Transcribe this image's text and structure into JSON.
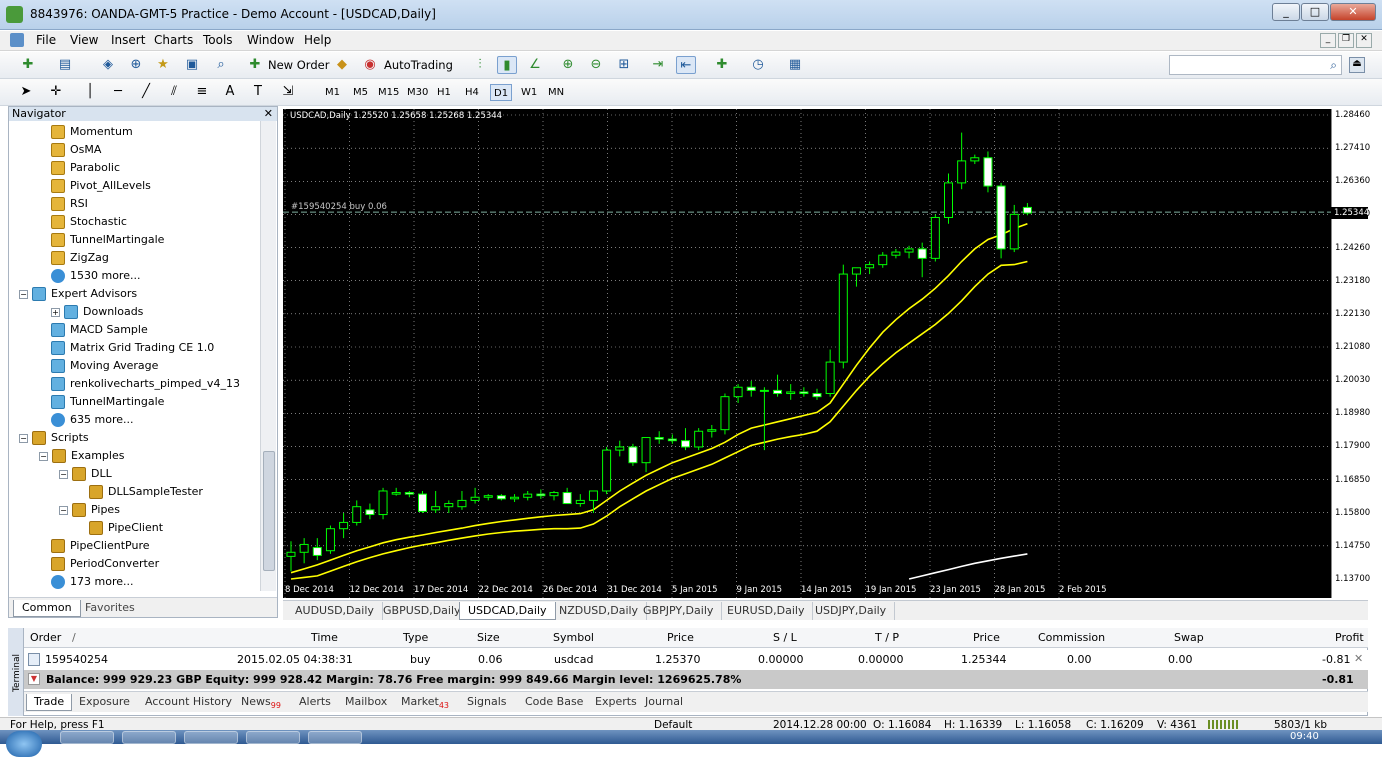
{
  "window": {
    "title": "8843976: OANDA-GMT-5 Practice - Demo Account - [USDCAD,Daily]",
    "buttons": [
      "_",
      "□",
      "✕"
    ]
  },
  "menu": [
    "File",
    "View",
    "Insert",
    "Charts",
    "Tools",
    "Window",
    "Help"
  ],
  "toolbar": {
    "new_order": "New Order",
    "autotrading": "AutoTrading",
    "timeframes": [
      "M1",
      "M5",
      "M15",
      "M30",
      "H1",
      "H4",
      "D1",
      "W1",
      "MN"
    ],
    "active_timeframe": "D1"
  },
  "navigator": {
    "title": "Navigator",
    "close": "✕",
    "items": [
      {
        "label": "Momentum",
        "icon": "indicator-icon"
      },
      {
        "label": "OsMA",
        "icon": "indicator-icon"
      },
      {
        "label": "Parabolic",
        "icon": "indicator-icon"
      },
      {
        "label": "Pivot_AllLevels",
        "icon": "indicator-icon"
      },
      {
        "label": "RSI",
        "icon": "indicator-icon"
      },
      {
        "label": "Stochastic",
        "icon": "indicator-icon"
      },
      {
        "label": "TunnelMartingale",
        "icon": "indicator-icon"
      },
      {
        "label": "ZigZag",
        "icon": "indicator-icon"
      },
      {
        "label": "1530 more...",
        "icon": "globe-icon"
      },
      {
        "label": "Expert Advisors",
        "icon": "expert-folder-icon"
      },
      {
        "label": "Downloads",
        "icon": "expert-icon"
      },
      {
        "label": "MACD Sample",
        "icon": "expert-icon"
      },
      {
        "label": "Matrix Grid Trading CE 1.0",
        "icon": "expert-icon"
      },
      {
        "label": "Moving Average",
        "icon": "expert-icon"
      },
      {
        "label": "renkolivecharts_pimped_v4_13",
        "icon": "expert-icon"
      },
      {
        "label": "TunnelMartingale",
        "icon": "expert-icon"
      },
      {
        "label": "635 more...",
        "icon": "globe-icon"
      },
      {
        "label": "Scripts",
        "icon": "script-folder-icon"
      },
      {
        "label": "Examples",
        "icon": "script-folder-icon"
      },
      {
        "label": "DLL",
        "icon": "script-folder-icon"
      },
      {
        "label": "DLLSampleTester",
        "icon": "script-icon"
      },
      {
        "label": "Pipes",
        "icon": "script-folder-icon"
      },
      {
        "label": "PipeClient",
        "icon": "script-icon"
      },
      {
        "label": "PipeClientPure",
        "icon": "script-icon"
      },
      {
        "label": "PeriodConverter",
        "icon": "script-icon"
      },
      {
        "label": "173 more...",
        "icon": "globe-icon"
      }
    ],
    "tabs": [
      "Common",
      "Favorites"
    ],
    "active_tab": "Common"
  },
  "chart": {
    "header": "USDCAD,Daily  1.25520 1.25658 1.25268 1.25344",
    "order_line_label": "#159540254 buy 0.06",
    "current_price": "1.25344",
    "price_ticks": [
      "1.28460",
      "1.27410",
      "1.26360",
      "1.25310",
      "1.24260",
      "1.23180",
      "1.22130",
      "1.21080",
      "1.20030",
      "1.18980",
      "1.17900",
      "1.16850",
      "1.15800",
      "1.14750",
      "1.13700"
    ],
    "date_ticks": [
      "8 Dec 2014",
      "12 Dec 2014",
      "17 Dec 2014",
      "22 Dec 2014",
      "26 Dec 2014",
      "31 Dec 2014",
      "5 Jan 2015",
      "9 Jan 2015",
      "14 Jan 2015",
      "19 Jan 2015",
      "23 Jan 2015",
      "28 Jan 2015",
      "2 Feb 2015"
    ],
    "tabs": [
      "AUDUSD,Daily",
      "GBPUSD,Daily",
      "USDCAD,Daily",
      "NZDUSD,Daily",
      "GBPJPY,Daily",
      "EURUSD,Daily",
      "USDJPY,Daily"
    ],
    "active_tab": "USDCAD,Daily"
  },
  "chart_data": {
    "type": "line",
    "title": "USDCAD,Daily",
    "ylim": [
      1.137,
      1.2846
    ],
    "candles": [
      [
        1.1442,
        1.149,
        1.1395,
        1.1455
      ],
      [
        1.1455,
        1.15,
        1.142,
        1.148
      ],
      [
        1.147,
        1.15,
        1.143,
        1.1445
      ],
      [
        1.146,
        1.154,
        1.145,
        1.153
      ],
      [
        1.153,
        1.158,
        1.15,
        1.155
      ],
      [
        1.155,
        1.162,
        1.154,
        1.16
      ],
      [
        1.159,
        1.161,
        1.156,
        1.1575
      ],
      [
        1.1575,
        1.166,
        1.156,
        1.165
      ],
      [
        1.164,
        1.166,
        1.1635,
        1.1645
      ],
      [
        1.1645,
        1.165,
        1.163,
        1.164
      ],
      [
        1.164,
        1.165,
        1.158,
        1.1585
      ],
      [
        1.159,
        1.165,
        1.158,
        1.16
      ],
      [
        1.16,
        1.162,
        1.158,
        1.161
      ],
      [
        1.16,
        1.165,
        1.159,
        1.162
      ],
      [
        1.162,
        1.166,
        1.161,
        1.163
      ],
      [
        1.163,
        1.164,
        1.162,
        1.1635
      ],
      [
        1.1635,
        1.164,
        1.162,
        1.1625
      ],
      [
        1.1625,
        1.164,
        1.1615,
        1.163
      ],
      [
        1.163,
        1.165,
        1.162,
        1.164
      ],
      [
        1.164,
        1.1655,
        1.1625,
        1.1635
      ],
      [
        1.1635,
        1.165,
        1.162,
        1.1645
      ],
      [
        1.1645,
        1.166,
        1.161,
        1.161
      ],
      [
        1.161,
        1.164,
        1.16,
        1.162
      ],
      [
        1.162,
        1.165,
        1.158,
        1.165
      ],
      [
        1.165,
        1.179,
        1.164,
        1.178
      ],
      [
        1.178,
        1.181,
        1.176,
        1.179
      ],
      [
        1.179,
        1.18,
        1.173,
        1.174
      ],
      [
        1.174,
        1.182,
        1.171,
        1.182
      ],
      [
        1.182,
        1.184,
        1.18,
        1.1815
      ],
      [
        1.1815,
        1.183,
        1.18,
        1.181
      ],
      [
        1.181,
        1.185,
        1.178,
        1.179
      ],
      [
        1.179,
        1.185,
        1.178,
        1.184
      ],
      [
        1.184,
        1.186,
        1.182,
        1.1845
      ],
      [
        1.1845,
        1.196,
        1.183,
        1.195
      ],
      [
        1.195,
        1.199,
        1.193,
        1.198
      ],
      [
        1.198,
        1.2,
        1.195,
        1.197
      ],
      [
        1.197,
        1.198,
        1.178,
        1.197
      ],
      [
        1.197,
        1.202,
        1.195,
        1.196
      ],
      [
        1.196,
        1.199,
        1.194,
        1.1965
      ],
      [
        1.1965,
        1.198,
        1.195,
        1.196
      ],
      [
        1.196,
        1.1975,
        1.194,
        1.195
      ],
      [
        1.196,
        1.21,
        1.195,
        1.206
      ],
      [
        1.206,
        1.237,
        1.204,
        1.234
      ],
      [
        1.234,
        1.236,
        1.23,
        1.236
      ],
      [
        1.236,
        1.238,
        1.234,
        1.237
      ],
      [
        1.237,
        1.241,
        1.236,
        1.24
      ],
      [
        1.24,
        1.242,
        1.239,
        1.241
      ],
      [
        1.241,
        1.243,
        1.239,
        1.242
      ],
      [
        1.242,
        1.244,
        1.233,
        1.239
      ],
      [
        1.239,
        1.253,
        1.238,
        1.252
      ],
      [
        1.252,
        1.266,
        1.25,
        1.263
      ],
      [
        1.263,
        1.279,
        1.261,
        1.27
      ],
      [
        1.27,
        1.272,
        1.269,
        1.271
      ],
      [
        1.271,
        1.273,
        1.26,
        1.262
      ],
      [
        1.262,
        1.263,
        1.239,
        1.242
      ],
      [
        1.242,
        1.256,
        1.241,
        1.253
      ],
      [
        1.2552,
        1.2566,
        1.2527,
        1.2534
      ]
    ],
    "series": [
      {
        "color": "#ffff00",
        "values": [
          1.139,
          1.1402,
          1.1415,
          1.143,
          1.1445,
          1.146,
          1.1472,
          1.1485,
          1.1495,
          1.1503,
          1.151,
          1.1518,
          1.1525,
          1.1532,
          1.154,
          1.1547,
          1.1553,
          1.1558,
          1.1563,
          1.1568,
          1.1572,
          1.1575,
          1.1578,
          1.159,
          1.162,
          1.165,
          1.1675,
          1.17,
          1.172,
          1.174,
          1.1755,
          1.177,
          1.1785,
          1.1805,
          1.183,
          1.185,
          1.186,
          1.187,
          1.188,
          1.189,
          1.19,
          1.193,
          1.199,
          1.205,
          1.2105,
          1.2155,
          1.2195,
          1.223,
          1.226,
          1.2295,
          1.2335,
          1.238,
          1.242,
          1.245,
          1.2465,
          1.2485,
          1.25
        ]
      },
      {
        "color": "#ffff00",
        "values": [
          1.137,
          1.1375,
          1.138,
          1.1395,
          1.141,
          1.1425,
          1.1438,
          1.145,
          1.146,
          1.147,
          1.1478,
          1.1485,
          1.1493,
          1.15,
          1.1507,
          1.1513,
          1.1518,
          1.1522,
          1.1525,
          1.1528,
          1.153,
          1.153,
          1.1532,
          1.1545,
          1.157,
          1.16,
          1.1625,
          1.165,
          1.167,
          1.169,
          1.1705,
          1.172,
          1.1735,
          1.1755,
          1.1775,
          1.1795,
          1.1805,
          1.1815,
          1.1823,
          1.183,
          1.184,
          1.187,
          1.192,
          1.197,
          1.2015,
          1.2055,
          1.209,
          1.212,
          1.215,
          1.218,
          1.2215,
          1.2255,
          1.23,
          1.234,
          1.2368,
          1.237,
          1.238
        ]
      },
      {
        "color": "#ffffff",
        "values": [
          null,
          null,
          null,
          null,
          null,
          null,
          null,
          null,
          null,
          null,
          null,
          null,
          null,
          null,
          null,
          null,
          null,
          null,
          null,
          null,
          null,
          null,
          null,
          null,
          null,
          null,
          null,
          null,
          null,
          null,
          null,
          null,
          null,
          null,
          null,
          null,
          null,
          null,
          null,
          null,
          null,
          null,
          null,
          null,
          null,
          null,
          null,
          1.137,
          1.138,
          1.139,
          1.14,
          1.141,
          1.142,
          1.1428,
          1.1436,
          1.1443,
          1.145
        ]
      }
    ],
    "order_price": 1.2537
  },
  "terminal": {
    "side_label": "Terminal",
    "columns": [
      "Order",
      "/",
      "Time",
      "Type",
      "Size",
      "Symbol",
      "Price",
      "S / L",
      "T / P",
      "Price",
      "Commission",
      "Swap",
      "Profit"
    ],
    "row": {
      "order": "159540254",
      "time": "2015.02.05 04:38:31",
      "type": "buy",
      "size": "0.06",
      "symbol": "usdcad",
      "price": "1.25370",
      "sl": "0.00000",
      "tp": "0.00000",
      "price2": "1.25344",
      "commission": "0.00",
      "swap": "0.00",
      "profit": "-0.81"
    },
    "balance_line": "Balance: 999 929.23 GBP  Equity: 999 928.42  Margin: 78.76  Free margin: 999 849.66  Margin level: 1269625.78%",
    "balance_profit": "-0.81",
    "tabs": [
      "Trade",
      "Exposure",
      "Account History",
      "News",
      "Alerts",
      "Mailbox",
      "Market",
      "Signals",
      "Code Base",
      "Experts",
      "Journal"
    ],
    "news_badge": "99",
    "market_badge": "43",
    "active_tab": "Trade"
  },
  "status": {
    "help": "For Help, press F1",
    "profile": "Default",
    "time": "2014.12.28 00:00",
    "open": "O: 1.16084",
    "high": "H: 1.16339",
    "low": "L: 1.16058",
    "close": "C: 1.16209",
    "volume": "V: 4361",
    "traffic": "5803/1 kb"
  },
  "taskbar": {
    "clock": "09:40"
  }
}
